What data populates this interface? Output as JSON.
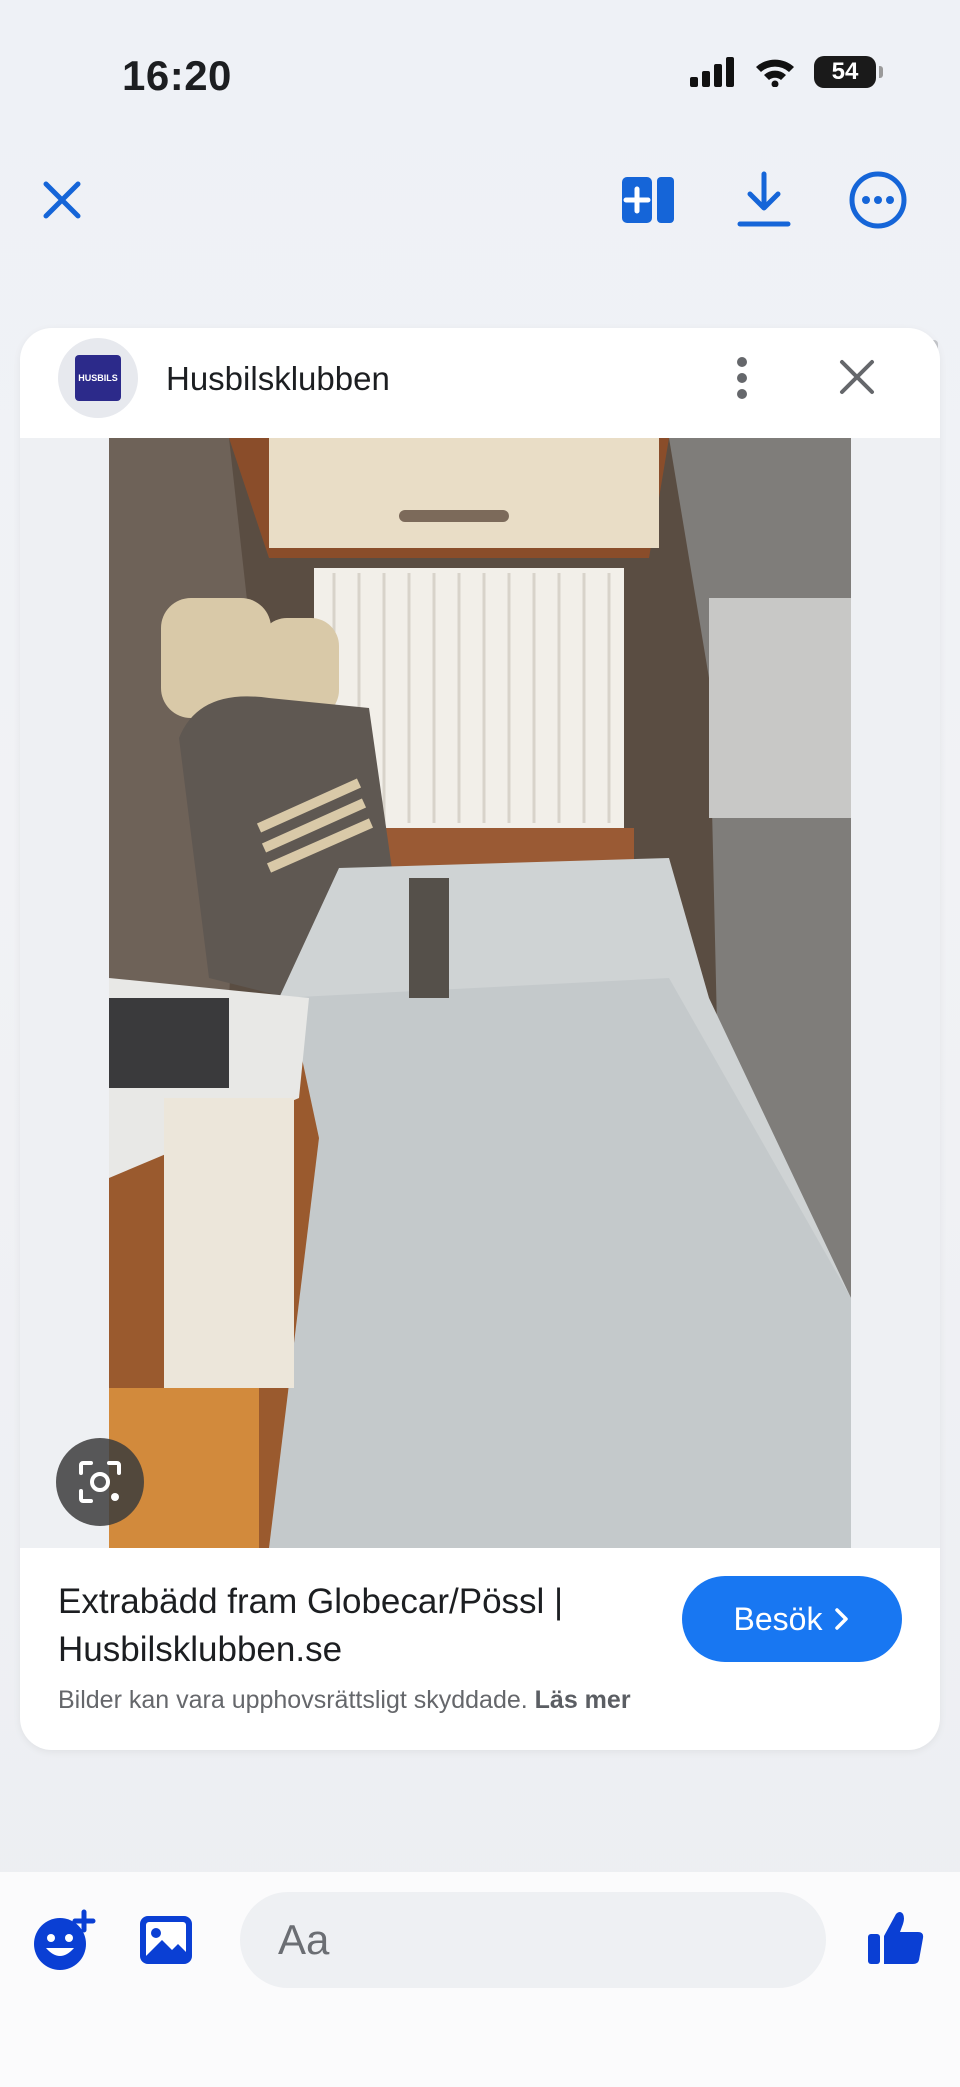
{
  "status_bar": {
    "time": "16:20",
    "battery": "54"
  },
  "toolbar": {
    "close_icon": "close-icon",
    "split_icon": "split-view-icon",
    "download_icon": "download-icon",
    "more_icon": "more-circle-icon"
  },
  "card": {
    "site_name": "Husbilsklubben",
    "avatar_text": "HUSBILS",
    "caption": "Extrabädd fram Globecar/Pössl | Husbilsklubben.se",
    "visit_label": "Besök",
    "copyright_text": "Bilder kan vara upphovsrättsligt skyddade.",
    "read_more_label": "Läs mer"
  },
  "composer": {
    "placeholder": "Aa"
  },
  "colors": {
    "accent": "#1877f2",
    "messenger_blue": "#0a3fd4"
  }
}
